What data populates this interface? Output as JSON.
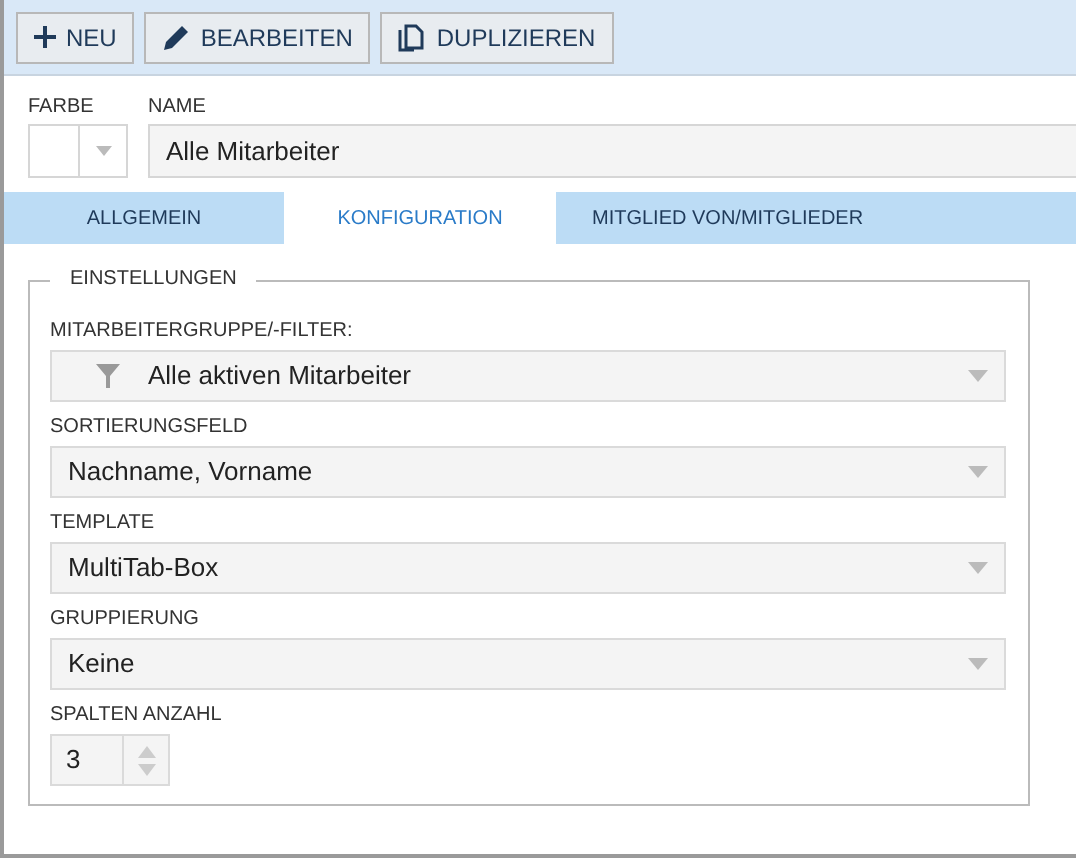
{
  "toolbar": [
    {
      "label": "NEU",
      "kind": "new"
    },
    {
      "label": "BEARBEITEN",
      "kind": "edit"
    },
    {
      "label": "DUPLIZIEREN",
      "kind": "duplicate"
    }
  ],
  "header": {
    "color_label": "FARBE",
    "name_label": "NAME",
    "name_value": "Alle Mitarbeiter"
  },
  "tabs": [
    {
      "label": "ALLGEMEIN",
      "selected": false
    },
    {
      "label": "KONFIGURATION",
      "selected": true
    },
    {
      "label": "MITGLIED VON/MITGLIEDER",
      "selected": false
    }
  ],
  "group": {
    "title": "EINSTELLUNGEN",
    "fields": [
      {
        "kind": "filter_select",
        "label": "MITARBEITERGRUPPE/-FILTER:",
        "value": "Alle aktiven Mitarbeiter"
      },
      {
        "kind": "select",
        "label": "SORTIERUNGSFELD",
        "value": "Nachname, Vorname"
      },
      {
        "kind": "select",
        "label": "TEMPLATE",
        "value": "MultiTab-Box"
      },
      {
        "kind": "select",
        "label": "GRUPPIERUNG",
        "value": "Keine"
      },
      {
        "kind": "number",
        "label": "SPALTEN ANZAHL",
        "value": "3"
      }
    ]
  }
}
